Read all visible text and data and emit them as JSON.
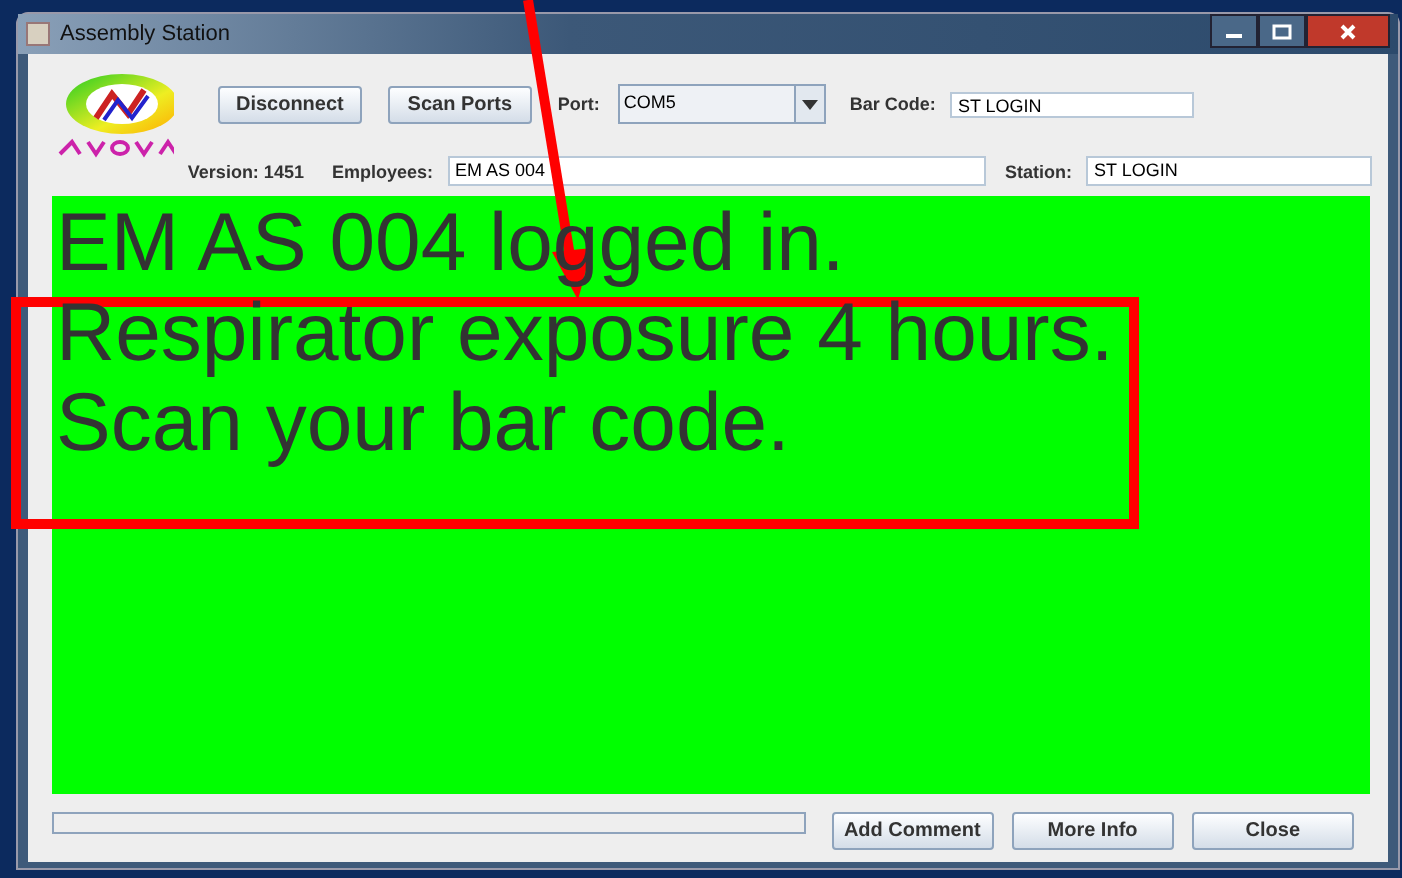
{
  "window": {
    "title": "Assembly Station"
  },
  "toolbar": {
    "buttons": [
      "Disconnect",
      "Scan Ports"
    ],
    "port_label": "Port:",
    "port_value": "COM5",
    "barcode_label": "Bar Code:",
    "barcode_value": "ST LOGIN"
  },
  "info": {
    "version": "Version: 1451",
    "employees_label": "Employees:",
    "employees_value": "EM AS 004",
    "station_label": "Station:",
    "station_value": "ST LOGIN"
  },
  "message": {
    "lines": [
      "EM AS 004 logged in.",
      "Respirator exposure 4 hours.",
      "Scan your bar code."
    ]
  },
  "progress": {
    "level": 0
  },
  "buttons": [
    "Add Comment",
    "More Info",
    "Close"
  ]
}
